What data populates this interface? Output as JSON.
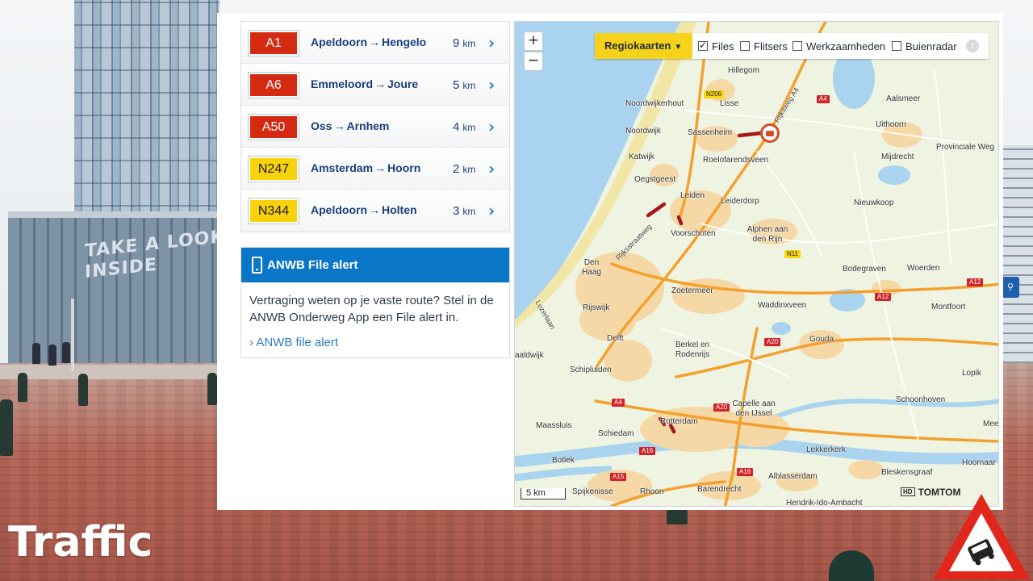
{
  "routes": [
    {
      "road": "A1",
      "type": "A",
      "from": "Apeldoorn",
      "to": "Hengelo",
      "distance": "9",
      "unit": "km"
    },
    {
      "road": "A6",
      "type": "A",
      "from": "Emmeloord",
      "to": "Joure",
      "distance": "5",
      "unit": "km"
    },
    {
      "road": "A50",
      "type": "A",
      "from": "Oss",
      "to": "Arnhem",
      "distance": "4",
      "unit": "km"
    },
    {
      "road": "N247",
      "type": "N",
      "from": "Amsterdam",
      "to": "Hoorn",
      "distance": "2",
      "unit": "km"
    },
    {
      "road": "N344",
      "type": "N",
      "from": "Apeldoorn",
      "to": "Holten",
      "distance": "3",
      "unit": "km"
    }
  ],
  "route_arrow": "→",
  "file_alert": {
    "title": "ANWB File alert",
    "body": "Vertraging weten op je vaste route? Stel in de ANWB Onderweg App een File alert in.",
    "link_label": "ANWB file alert"
  },
  "map": {
    "zoom_in": "+",
    "zoom_out": "−",
    "regio_label": "Regiokaarten",
    "options": [
      {
        "label": "Files",
        "checked": true
      },
      {
        "label": "Flitsers",
        "checked": false
      },
      {
        "label": "Werkzaamheden",
        "checked": false
      },
      {
        "label": "Buienradar",
        "checked": false
      }
    ],
    "info": "i",
    "places": [
      "Hillegom",
      "Lisse",
      "Aalsmeer",
      "Noordwijkerhout",
      "Noordwijk",
      "Sassenheim",
      "Uithoorn",
      "Provinciale Weg",
      "Mijdrecht",
      "Katwijk",
      "Roelofarendsveen",
      "Oegstgeest",
      "Leiden",
      "Leiderdorp",
      "Nieuwkoop",
      "Alphen aan den Rijn",
      "Voorschoten",
      "Den Haag",
      "Bodegraven",
      "Woerden",
      "Zoetermeer",
      "Rijswijk",
      "Waddinxveen",
      "Montfoort",
      "Delft",
      "Gouda",
      "Berkel en Rodenrijs",
      "aaldwijk",
      "Schipluiden",
      "Lopik",
      "Capelle aan den IJssel",
      "Schoonhoven",
      "Maassluis",
      "Rotterdam",
      "Meerk",
      "Schiedam",
      "Lekkerkerk",
      "Botlek",
      "Hoornaar",
      "Bleskensgraaf",
      "Alblasserdam",
      "Spijkenisse",
      "Rhoon",
      "Barendrecht",
      "Hendrik-Ido-Ambacht"
    ],
    "road_names": [
      "Rijksstraatweg",
      "Rijksweg A4",
      "Lozerlaan"
    ],
    "road_tags": [
      "N206",
      "A4",
      "N11",
      "A12",
      "A12",
      "A20",
      "A20",
      "A4",
      "A16",
      "A15",
      "A16"
    ],
    "scale": "5 km",
    "attribution_hd": "HD",
    "attribution": "TOMTOM"
  },
  "caption": "Traffic",
  "colors": {
    "a_road": "#d42a12",
    "n_road": "#f8d20c",
    "link_blue": "#1a3e7c",
    "alert_blue": "#0a76c8",
    "regio_yellow": "#f6d21a",
    "jam_red": "#a8171c"
  }
}
